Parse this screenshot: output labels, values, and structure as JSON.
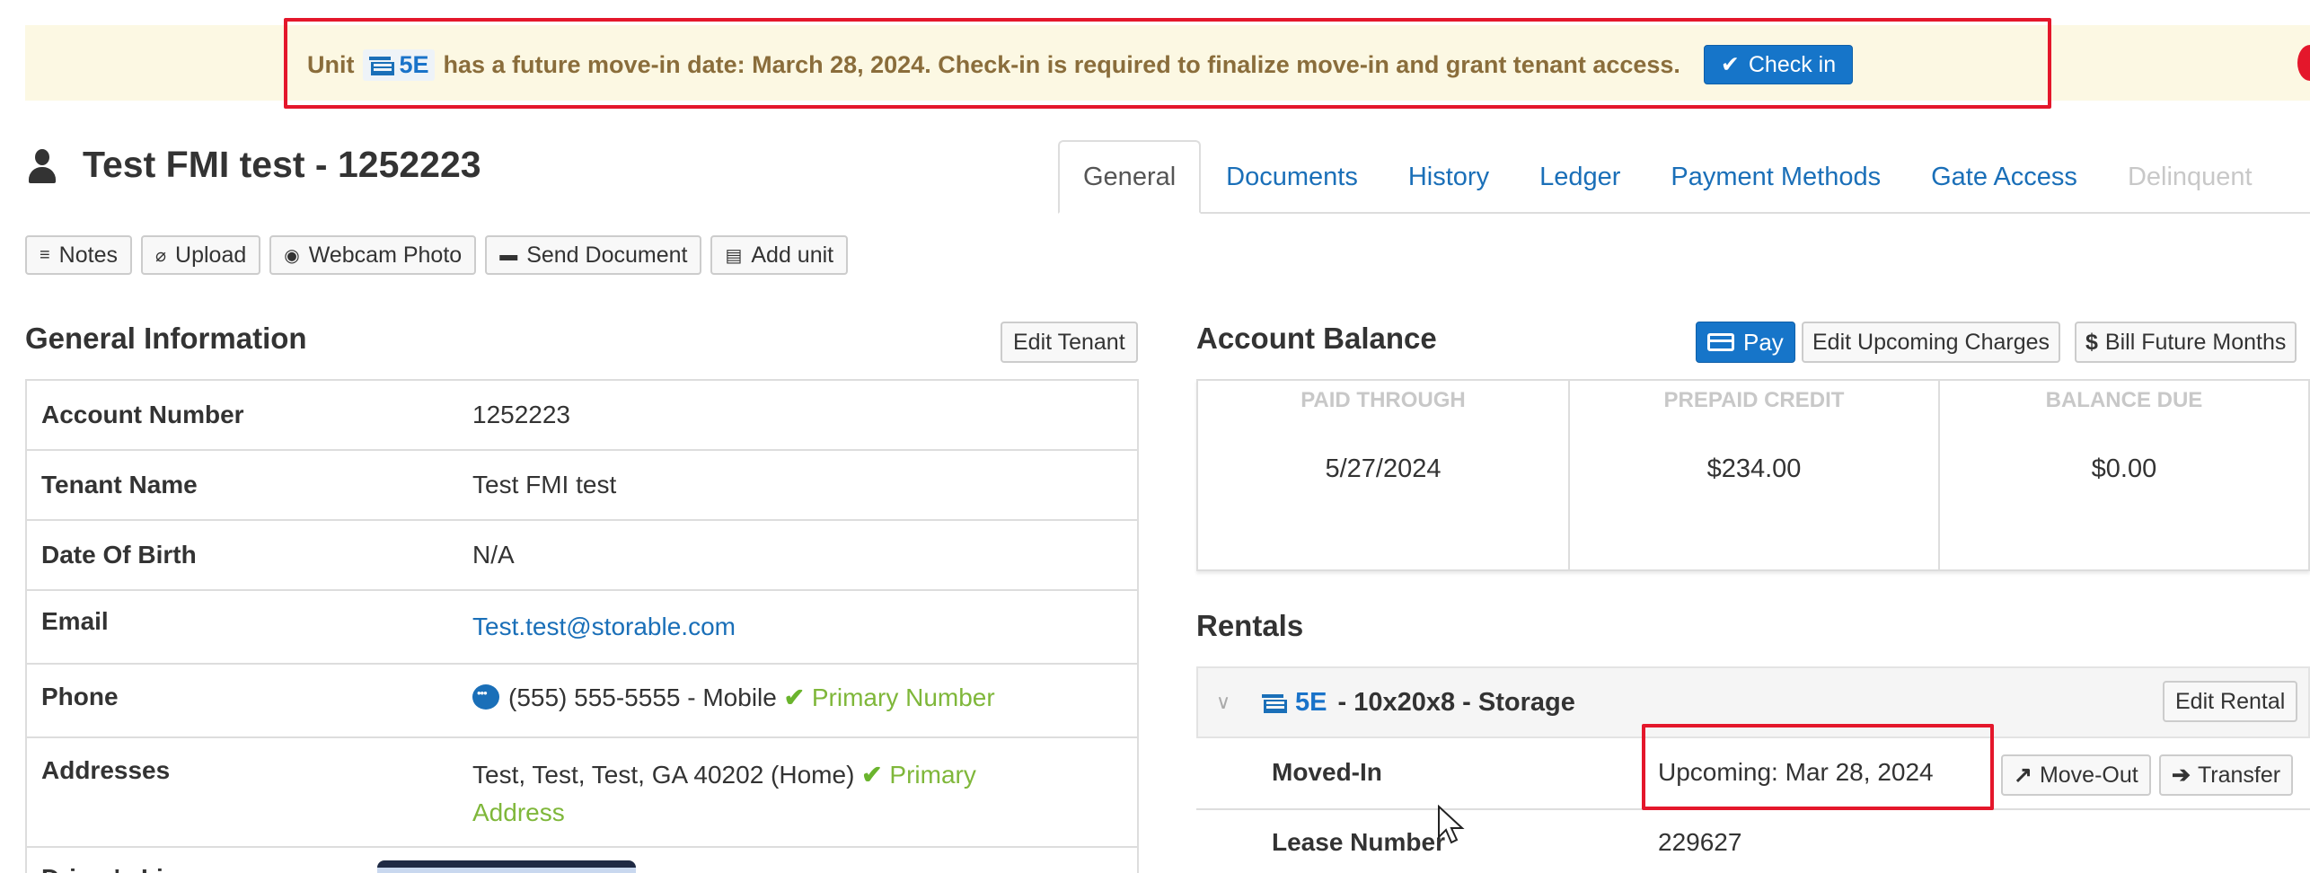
{
  "alert": {
    "prefix": "Unit",
    "unit": "5E",
    "message": "has a future move-in date: March 28, 2024. Check-in is required to finalize move-in and grant tenant access.",
    "checkin_label": "Check in",
    "colors": {
      "background": "#fcf8e3",
      "text": "#8a6d3b",
      "highlight": "#e4172b"
    }
  },
  "header": {
    "title": "Test FMI test - 1252223",
    "tabs": [
      {
        "label": "General",
        "active": true
      },
      {
        "label": "Documents"
      },
      {
        "label": "History"
      },
      {
        "label": "Ledger"
      },
      {
        "label": "Payment Methods"
      },
      {
        "label": "Gate Access"
      },
      {
        "label": "Delinquent",
        "disabled": true
      }
    ]
  },
  "toolbar": {
    "notes": "Notes",
    "upload": "Upload",
    "webcam": "Webcam Photo",
    "send_document": "Send Document",
    "add_unit": "Add unit"
  },
  "general": {
    "heading": "General Information",
    "edit_label": "Edit Tenant",
    "rows": [
      {
        "label": "Account Number",
        "value": "1252223"
      },
      {
        "label": "Tenant Name",
        "value": "Test FMI test"
      },
      {
        "label": "Date Of Birth",
        "value": "N/A"
      },
      {
        "label": "Email",
        "value": "Test.test@storable.com"
      },
      {
        "label": "Phone",
        "value": "(555) 555-5555 - Mobile",
        "tag": "Primary Number"
      },
      {
        "label": "Addresses",
        "value": "Test, Test, Test, GA 40202 (Home)",
        "tag": "Primary",
        "tag2": "Address"
      },
      {
        "label": "Driver's License"
      }
    ]
  },
  "balance": {
    "heading": "Account Balance",
    "pay_label": "Pay",
    "edit_charges_label": "Edit Upcoming Charges",
    "bill_future_label": "Bill Future Months",
    "stats": [
      {
        "label": "PAID THROUGH",
        "value": "5/27/2024"
      },
      {
        "label": "PREPAID CREDIT",
        "value": "$234.00"
      },
      {
        "label": "BALANCE DUE",
        "value": "$0.00"
      }
    ]
  },
  "rentals": {
    "heading": "Rentals",
    "unit": "5E",
    "unit_desc": "- 10x20x8 - Storage",
    "edit_label": "Edit Rental",
    "moved_in_label": "Moved-In",
    "moved_in_value": "Upcoming: Mar 28, 2024",
    "move_out_label": "Move-Out",
    "transfer_label": "Transfer",
    "lease_label": "Lease Number",
    "lease_value": "229627"
  },
  "icons": {
    "person": "person-icon",
    "unit": "storage-unit-icon",
    "check": "checkmark-icon",
    "chat": "chat-icon",
    "notes": "list-icon",
    "upload": "paperclip-icon",
    "webcam": "camera-icon",
    "send_document": "folder-icon",
    "add_unit": "storage-unit-icon",
    "pay": "credit-card-icon",
    "bill_future": "dollar-icon",
    "move_out": "arrow-out-icon",
    "transfer": "arrow-right-icon",
    "expand": "chevron-down-icon"
  }
}
